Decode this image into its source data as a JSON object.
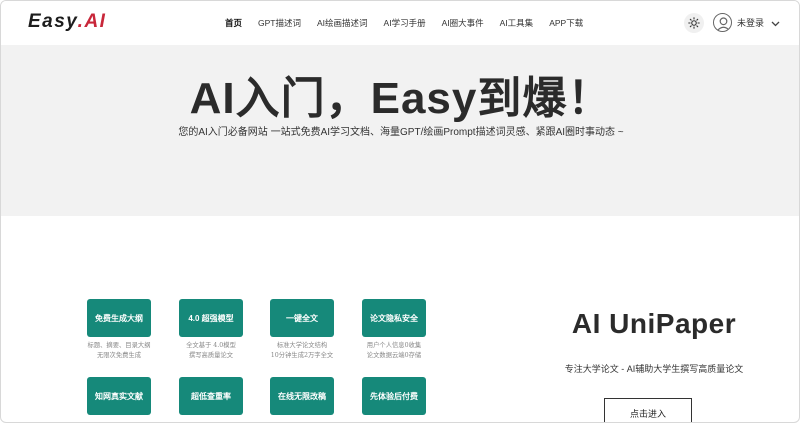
{
  "header": {
    "logo_text": "Easy",
    "logo_dot": ".",
    "logo_accent": "AI",
    "nav": [
      "首页",
      "GPT描述词",
      "AI绘画描述词",
      "AI学习手册",
      "AI圈大事件",
      "AI工具集",
      "APP下载"
    ],
    "theme_icon": "sun-icon",
    "user_icon": "user-avatar-icon",
    "user_label": "未登录"
  },
  "hero": {
    "title": "AI入门，Easy到爆！",
    "subtitle": "您的AI入门必备网站 一站式免费AI学习文档、海量GPT/绘画Prompt描述词灵感、紧跟AI圈时事动态 ~"
  },
  "features": [
    {
      "label": "免费生成大纲",
      "desc": [
        "标题、摘要、目录大纲",
        "无限次免费生成"
      ]
    },
    {
      "label": "4.0 超强模型",
      "desc": [
        "全文基于 4.0模型",
        "撰写高质量论文"
      ]
    },
    {
      "label": "一键全文",
      "desc": [
        "标准大学论文结构",
        "10分钟生成2万字全文"
      ]
    },
    {
      "label": "论文隐私安全",
      "desc": [
        "用户个人信息0收集",
        "论文数据云端0存储"
      ]
    },
    {
      "label": "知网真实文献",
      "desc": [
        "",
        ""
      ]
    },
    {
      "label": "超低查重率",
      "desc": [
        "",
        ""
      ]
    },
    {
      "label": "在线无限改稿",
      "desc": [
        "",
        ""
      ]
    },
    {
      "label": "先体验后付费",
      "desc": [
        "",
        ""
      ]
    }
  ],
  "panel": {
    "title": "AI UniPaper",
    "subtitle": "专注大学论文 - AI辅助大学生撰写高质量论文",
    "button": "点击进入"
  },
  "colors": {
    "accent_red": "#c8273a",
    "feature_green": "#16897a",
    "hero_bg": "#f2f2f2"
  }
}
